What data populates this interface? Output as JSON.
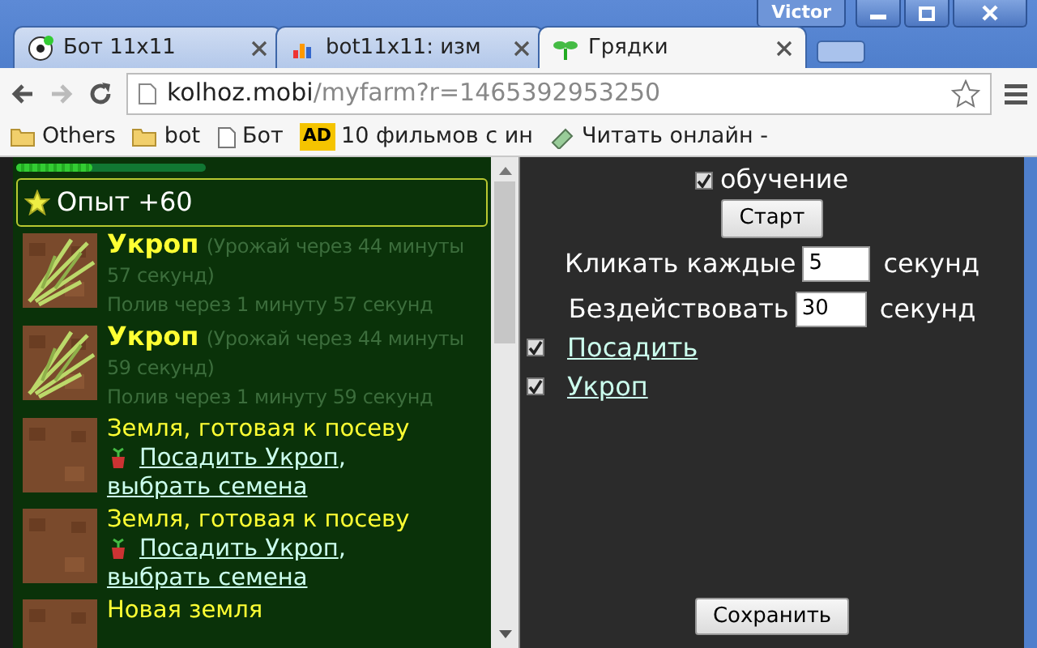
{
  "window": {
    "user": "Victor"
  },
  "tabs": [
    {
      "title": "Бот 11x11",
      "kind": "ball",
      "selected": false
    },
    {
      "title": "bot11x11: изм",
      "kind": "chart",
      "selected": false
    },
    {
      "title": "Грядки",
      "kind": "sprout",
      "selected": true
    }
  ],
  "address": {
    "host": "kolhoz.mobi",
    "path": "/myfarm?r=1465392953250"
  },
  "bookmarks": [
    {
      "label": "Others",
      "kind": "folder"
    },
    {
      "label": "bot",
      "kind": "folder"
    },
    {
      "label": "Бот",
      "kind": "page"
    },
    {
      "label": "10 фильмов с ин",
      "kind": "ad",
      "badge": "AD"
    },
    {
      "label": "Читать онлайн -",
      "kind": "book"
    }
  ],
  "game": {
    "progress": {
      "level": 0.4
    },
    "notice": "Опыт +60",
    "plots": [
      {
        "kind": "crop",
        "name": "Укроп",
        "harvest": "(Урожай через 44 минуты 57 секунд)",
        "water": "Полив через 1 минуту 57 секунд"
      },
      {
        "kind": "crop",
        "name": "Укроп",
        "harvest": "(Урожай через 44 минуты 59 секунд)",
        "water": "Полив через 1 минуту 59 секунд"
      },
      {
        "kind": "soil",
        "title": "Земля, готовая к посеву",
        "plant": "Посадить Укроп",
        "separator": ",",
        "choose": "выбрать семена"
      },
      {
        "kind": "soil",
        "title": "Земля, готовая к посеву",
        "plant": "Посадить Укроп",
        "separator": ",",
        "choose": "выбрать семена"
      },
      {
        "kind": "new",
        "title": "Новая земля"
      }
    ]
  },
  "bot": {
    "tutorial": {
      "label": "обучение",
      "checked": true
    },
    "start": "Старт",
    "settings": [
      {
        "label": "Кликать каждые",
        "value": "5",
        "unit": "секунд"
      },
      {
        "label": "Бездействовать",
        "value": "30",
        "unit": "секунд"
      }
    ],
    "options": [
      {
        "label": "Посадить",
        "checked": true
      },
      {
        "label": "Укроп",
        "checked": true
      }
    ],
    "save": "Сохранить"
  }
}
